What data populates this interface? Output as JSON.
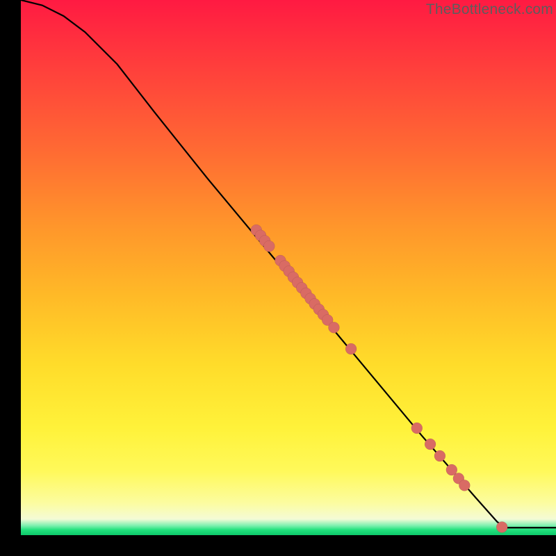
{
  "watermark": "TheBottleneck.com",
  "chart_data": {
    "type": "line",
    "title": "",
    "xlabel": "",
    "ylabel": "",
    "xlim": [
      0,
      100
    ],
    "ylim": [
      0,
      100
    ],
    "curve": [
      {
        "x": 0,
        "y": 100
      },
      {
        "x": 4,
        "y": 99
      },
      {
        "x": 8,
        "y": 97
      },
      {
        "x": 12,
        "y": 94
      },
      {
        "x": 18,
        "y": 88
      },
      {
        "x": 25,
        "y": 79
      },
      {
        "x": 35,
        "y": 66.5
      },
      {
        "x": 45,
        "y": 54.5
      },
      {
        "x": 55,
        "y": 42.5
      },
      {
        "x": 65,
        "y": 30.5
      },
      {
        "x": 75,
        "y": 18.5
      },
      {
        "x": 85,
        "y": 7.0
      },
      {
        "x": 89,
        "y": 2.5
      },
      {
        "x": 90.5,
        "y": 1.4
      },
      {
        "x": 100,
        "y": 1.4
      }
    ],
    "series": [
      {
        "name": "cluster-points",
        "points": [
          {
            "x": 44.0,
            "y": 57.0
          },
          {
            "x": 44.8,
            "y": 56.0
          },
          {
            "x": 45.6,
            "y": 55.0
          },
          {
            "x": 46.4,
            "y": 54.0
          },
          {
            "x": 48.5,
            "y": 51.3
          },
          {
            "x": 49.3,
            "y": 50.3
          },
          {
            "x": 50.1,
            "y": 49.3
          },
          {
            "x": 50.9,
            "y": 48.2
          },
          {
            "x": 51.7,
            "y": 47.2
          },
          {
            "x": 52.5,
            "y": 46.2
          },
          {
            "x": 53.3,
            "y": 45.2
          },
          {
            "x": 54.1,
            "y": 44.2
          },
          {
            "x": 54.9,
            "y": 43.2
          },
          {
            "x": 55.7,
            "y": 42.2
          },
          {
            "x": 56.5,
            "y": 41.2
          },
          {
            "x": 57.3,
            "y": 40.2
          },
          {
            "x": 58.5,
            "y": 38.8
          },
          {
            "x": 61.7,
            "y": 34.8
          },
          {
            "x": 74.0,
            "y": 20.0
          },
          {
            "x": 76.5,
            "y": 17.0
          },
          {
            "x": 78.3,
            "y": 14.8
          },
          {
            "x": 80.5,
            "y": 12.2
          },
          {
            "x": 81.8,
            "y": 10.6
          },
          {
            "x": 82.9,
            "y": 9.3
          },
          {
            "x": 89.9,
            "y": 1.5
          }
        ]
      }
    ]
  }
}
